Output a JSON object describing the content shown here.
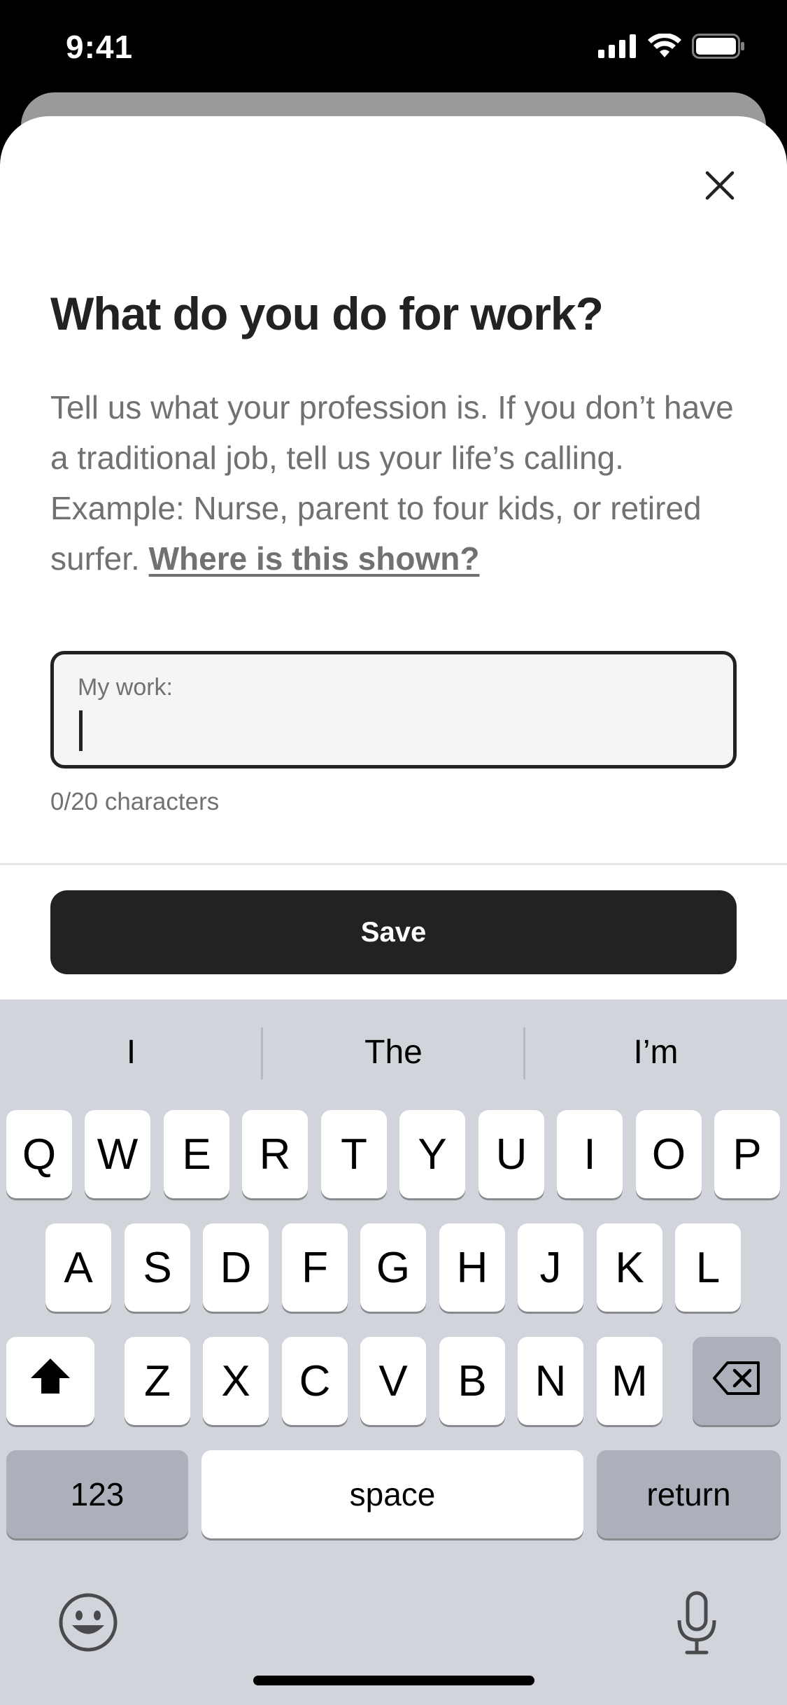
{
  "status_bar": {
    "time": "9:41"
  },
  "modal": {
    "title": "What do you do for work?",
    "description": "Tell us what your profession is. If you don’t have a traditional job, tell us your life’s calling. Example: Nurse, parent to four kids, or retired surfer.",
    "help_link": "Where is this shown?",
    "field_label": "My work:",
    "field_value": "",
    "counter": "0/20 characters",
    "save_label": "Save"
  },
  "keyboard": {
    "suggestions": [
      "I",
      "The",
      "I’m"
    ],
    "row1": [
      "Q",
      "W",
      "E",
      "R",
      "T",
      "Y",
      "U",
      "I",
      "O",
      "P"
    ],
    "row2": [
      "A",
      "S",
      "D",
      "F",
      "G",
      "H",
      "J",
      "K",
      "L"
    ],
    "row3": [
      "Z",
      "X",
      "C",
      "V",
      "B",
      "N",
      "M"
    ],
    "numbers_label": "123",
    "space_label": "space",
    "return_label": "return",
    "icons": [
      "shift-icon",
      "backspace-icon",
      "emoji-icon",
      "microphone-icon"
    ]
  }
}
